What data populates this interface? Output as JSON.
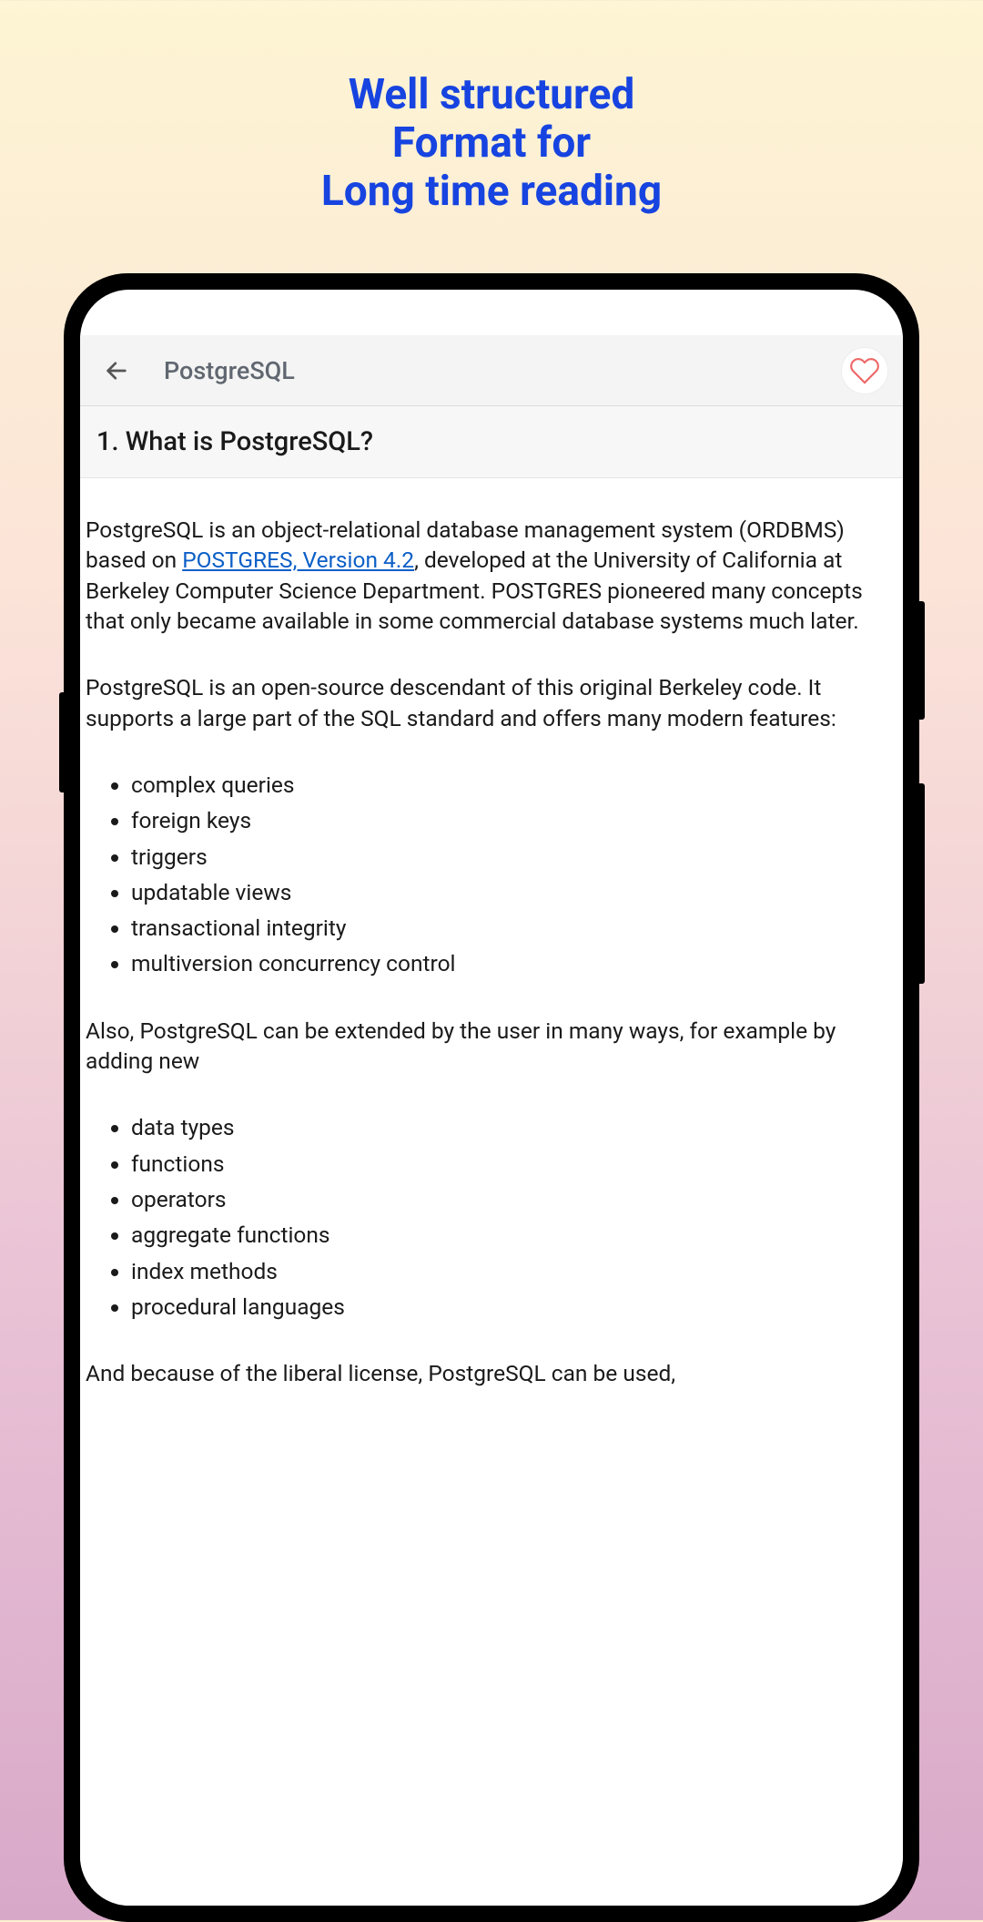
{
  "hero": {
    "line1": "Well structured",
    "line2": "Format for",
    "line3": "Long time reading"
  },
  "appbar": {
    "title": "PostgreSQL"
  },
  "section": {
    "title": "1.  What is PostgreSQL?"
  },
  "content": {
    "p1_before": "PostgreSQL is an object-relational database management system (ORDBMS) based on ",
    "p1_link": "POSTGRES, Version 4.2",
    "p1_after": ", developed at the University of California at Berkeley Computer Science Department. POSTGRES pioneered many concepts that only became available in some commercial database systems much later.",
    "p2": "PostgreSQL is an open-source descendant of this original Berkeley code. It supports a large part of the SQL standard and offers many modern features:",
    "features": {
      "0": "complex queries",
      "1": "foreign keys",
      "2": "triggers",
      "3": "updatable views",
      "4": "transactional integrity",
      "5": "multiversion concurrency control"
    },
    "p3": "Also, PostgreSQL can be extended by the user in many ways, for example by adding new",
    "extensions": {
      "0": "data types",
      "1": "functions",
      "2": "operators",
      "3": "aggregate functions",
      "4": "index methods",
      "5": "procedural languages"
    },
    "p4": "And because of the liberal license, PostgreSQL can be used,"
  }
}
